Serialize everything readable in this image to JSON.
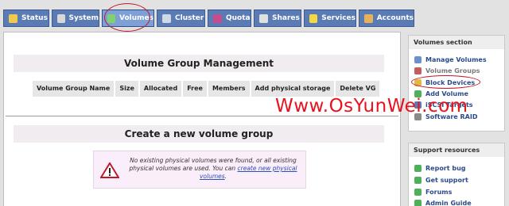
{
  "tabs": [
    {
      "label": "Status",
      "icon": "status-icon"
    },
    {
      "label": "System",
      "icon": "system-icon"
    },
    {
      "label": "Volumes",
      "icon": "volumes-icon",
      "active": true
    },
    {
      "label": "Cluster",
      "icon": "cluster-icon"
    },
    {
      "label": "Quota",
      "icon": "quota-icon"
    },
    {
      "label": "Shares",
      "icon": "shares-icon"
    },
    {
      "label": "Services",
      "icon": "services-icon"
    },
    {
      "label": "Accounts",
      "icon": "accounts-icon"
    }
  ],
  "main": {
    "vg_title": "Volume Group Management",
    "columns": [
      "Volume Group Name",
      "Size",
      "Allocated",
      "Free",
      "Members",
      "Add physical storage",
      "Delete VG"
    ],
    "create_title": "Create a new volume group",
    "warning": {
      "text_line1": "No existing physical volumes were found, or all existing",
      "text_line2_prefix": "physical volumes are used. You can ",
      "link": "create new physical volumes",
      "suffix": "."
    }
  },
  "sidebar": {
    "volumes_section": {
      "title": "Volumes section",
      "items": [
        {
          "label": "Manage Volumes",
          "icon": "manage-volumes-icon"
        },
        {
          "label": "Volume Groups",
          "icon": "volume-groups-icon"
        },
        {
          "label": "Block Devices",
          "icon": "block-devices-icon"
        },
        {
          "label": "Add Volume",
          "icon": "add-volume-icon"
        },
        {
          "label": "iSCSI Targets",
          "icon": "iscsi-icon"
        },
        {
          "label": "Software RAID",
          "icon": "raid-icon"
        }
      ]
    },
    "support": {
      "title": "Support resources",
      "items": [
        {
          "label": "Report bug",
          "icon": "bug-icon"
        },
        {
          "label": "Get support",
          "icon": "support-icon"
        },
        {
          "label": "Forums",
          "icon": "forums-icon"
        },
        {
          "label": "Admin Guide",
          "icon": "guide-icon"
        }
      ]
    }
  },
  "watermark": "Www.OsYunWei.com",
  "colors": {
    "tab_bg": "#5b7bb4",
    "active_tab": "#7fa0d6",
    "annotation_red": "#c0182a",
    "watermark": "#e8121f"
  }
}
